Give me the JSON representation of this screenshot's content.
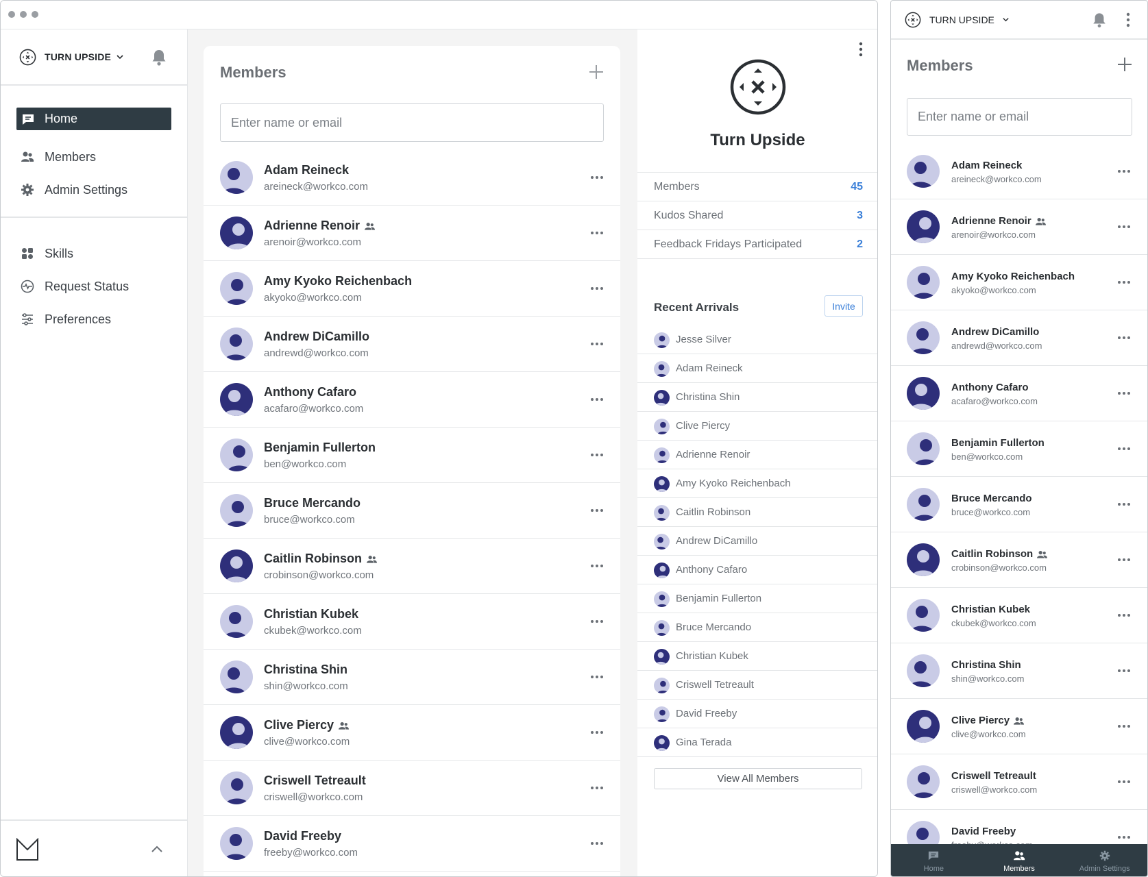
{
  "org": {
    "name": "TURN UPSIDE",
    "display_name": "Turn Upside"
  },
  "sidebar": {
    "primary": [
      {
        "label": "Home",
        "icon": "chat-icon",
        "active": true
      },
      {
        "label": "Members",
        "icon": "members-icon",
        "active": false
      },
      {
        "label": "Admin Settings",
        "icon": "gear-icon",
        "active": false
      }
    ],
    "secondary": [
      {
        "label": "Skills",
        "icon": "skills-icon"
      },
      {
        "label": "Request Status",
        "icon": "pulse-icon"
      },
      {
        "label": "Preferences",
        "icon": "sliders-icon"
      }
    ]
  },
  "members_panel": {
    "title": "Members",
    "search_placeholder": "Enter name or email",
    "members": [
      {
        "name": "Adam Reineck",
        "email": "areineck@workco.com",
        "group": false
      },
      {
        "name": "Adrienne Renoir",
        "email": "arenoir@workco.com",
        "group": true
      },
      {
        "name": "Amy Kyoko Reichenbach",
        "email": "akyoko@workco.com",
        "group": false
      },
      {
        "name": "Andrew DiCamillo",
        "email": "andrewd@workco.com",
        "group": false
      },
      {
        "name": "Anthony Cafaro",
        "email": "acafaro@workco.com",
        "group": false
      },
      {
        "name": "Benjamin Fullerton",
        "email": "ben@workco.com",
        "group": false
      },
      {
        "name": "Bruce Mercando",
        "email": "bruce@workco.com",
        "group": false
      },
      {
        "name": "Caitlin Robinson",
        "email": "crobinson@workco.com",
        "group": true
      },
      {
        "name": "Christian Kubek",
        "email": "ckubek@workco.com",
        "group": false
      },
      {
        "name": "Christina Shin",
        "email": "shin@workco.com",
        "group": false
      },
      {
        "name": "Clive Piercy",
        "email": "clive@workco.com",
        "group": true
      },
      {
        "name": "Criswell Tetreault",
        "email": "criswell@workco.com",
        "group": false
      },
      {
        "name": "David Freeby",
        "email": "freeby@workco.com",
        "group": false
      }
    ]
  },
  "org_panel": {
    "stats": [
      {
        "label": "Members",
        "value": "45"
      },
      {
        "label": "Kudos Shared",
        "value": "3"
      },
      {
        "label": "Feedback Fridays Participated",
        "value": "2"
      }
    ],
    "recent_arrivals_title": "Recent Arrivals",
    "invite_label": "Invite",
    "recent_arrivals": [
      "Jesse Silver",
      "Adam Reineck",
      "Christina Shin",
      "Clive Piercy",
      "Adrienne Renoir",
      "Amy Kyoko Reichenbach",
      "Caitlin Robinson",
      "Andrew DiCamillo",
      "Anthony Cafaro",
      "Benjamin Fullerton",
      "Bruce Mercando",
      "Christian Kubek",
      "Criswell Tetreault",
      "David Freeby",
      "Gina Terada"
    ],
    "view_all_label": "View All Members"
  },
  "mobile": {
    "org_name": "TURN UPSIDE",
    "title": "Members",
    "search_placeholder": "Enter name or email",
    "members": [
      {
        "name": "Adam Reineck",
        "email": "areineck@workco.com",
        "group": false
      },
      {
        "name": "Adrienne Renoir",
        "email": "arenoir@workco.com",
        "group": true
      },
      {
        "name": "Amy Kyoko Reichenbach",
        "email": "akyoko@workco.com",
        "group": false
      },
      {
        "name": "Andrew DiCamillo",
        "email": "andrewd@workco.com",
        "group": false
      },
      {
        "name": "Anthony Cafaro",
        "email": "acafaro@workco.com",
        "group": false
      },
      {
        "name": "Benjamin Fullerton",
        "email": "ben@workco.com",
        "group": false
      },
      {
        "name": "Bruce Mercando",
        "email": "bruce@workco.com",
        "group": false
      },
      {
        "name": "Caitlin Robinson",
        "email": "crobinson@workco.com",
        "group": true
      },
      {
        "name": "Christian Kubek",
        "email": "ckubek@workco.com",
        "group": false
      },
      {
        "name": "Christina Shin",
        "email": "shin@workco.com",
        "group": false
      },
      {
        "name": "Clive Piercy",
        "email": "clive@workco.com",
        "group": true
      },
      {
        "name": "Criswell Tetreault",
        "email": "criswell@workco.com",
        "group": false
      },
      {
        "name": "David Freeby",
        "email": "freeby@workco.com",
        "group": false
      }
    ],
    "tabs": [
      {
        "label": "Home",
        "icon": "chat-icon",
        "active": false
      },
      {
        "label": "Members",
        "icon": "members-icon",
        "active": true
      },
      {
        "label": "Admin Settings",
        "icon": "gear-icon",
        "active": false
      }
    ]
  },
  "colors": {
    "accent": "#3a7fd8",
    "nav_active_bg": "#2f3c44",
    "avatar_tint": "#2e2f7a",
    "avatar_light": "#c9cbe6"
  }
}
